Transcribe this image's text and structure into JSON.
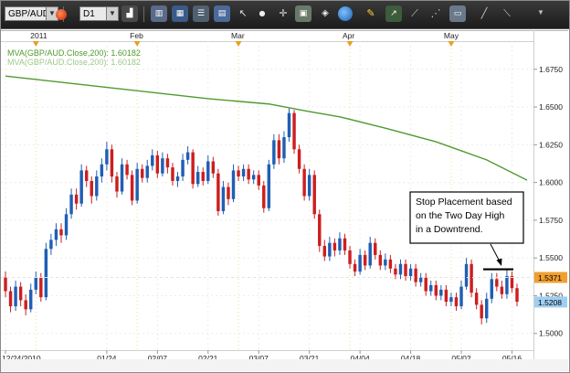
{
  "toolbar": {
    "symbol": "GBP/AUD",
    "timeframe": "D1",
    "icons": [
      "record-icon",
      "bar-chart-icon",
      "candle-icon",
      "line-chart-icon",
      "cursor-icon",
      "dot-icon",
      "crosshair-icon",
      "zoom-in-icon",
      "zoom-out-icon",
      "globe-icon",
      "pencil-icon",
      "trendline-icon",
      "channel-icon",
      "fibonacci-icon",
      "text-icon",
      "shapes-icon",
      "arrow-icon"
    ]
  },
  "colors": {
    "up": "#1f5fb4",
    "down": "#cc1f1f",
    "ma": "#4f9a2f",
    "ma_faint": "#9cc98a",
    "month_marker": "#e8a020",
    "price_box_orange": "#f0a030",
    "price_box_blue": "#9fcff0"
  },
  "chart_data": {
    "type": "candlestick",
    "symbol": "GBP/AUD",
    "ylim": [
      1.495,
      1.69
    ],
    "y_ticks": [
      "1.6750",
      "1.6500",
      "1.6250",
      "1.6000",
      "1.5750",
      "1.5500",
      "1.5250",
      "1.5000"
    ],
    "y_tick_values": [
      1.675,
      1.65,
      1.625,
      1.6,
      1.575,
      1.55,
      1.525,
      1.5
    ],
    "x_tick_labels": [
      "12/24/2010",
      "01/24",
      "02/07",
      "02/21",
      "03/07",
      "03/21",
      "04/04",
      "04/18",
      "05/02",
      "05/16"
    ],
    "x_tick_index": [
      0,
      20,
      30,
      40,
      50,
      60,
      70,
      80,
      90,
      100
    ],
    "month_labels": [
      "2011",
      "Feb",
      "Mar",
      "Apr",
      "May"
    ],
    "month_index": [
      6,
      26,
      46,
      68,
      88
    ],
    "legend": [
      "MVA(GBP/AUD.Close,200): 1.60182",
      "MVA(GBP/AUD.Close,200): 1.60182"
    ],
    "price_labels": {
      "current": "1.5371",
      "bid": "1.5208"
    },
    "price_values": {
      "current": 1.5371,
      "bid": 1.5208
    },
    "annotation": [
      "Stop Placement based",
      "on the Two Day High",
      "in a Downtrend."
    ],
    "stop_level": 1.5425,
    "ma": {
      "from_index": 0,
      "to_index": 103,
      "from_value": 1.6705,
      "to_value": 1.6015,
      "points": [
        [
          0,
          1.6705
        ],
        [
          20,
          1.663
        ],
        [
          40,
          1.6555
        ],
        [
          52,
          1.652
        ],
        [
          60,
          1.647
        ],
        [
          66,
          1.6435
        ],
        [
          75,
          1.636
        ],
        [
          85,
          1.627
        ],
        [
          95,
          1.615
        ],
        [
          103,
          1.6015
        ]
      ]
    },
    "candles": [
      [
        1.537,
        1.528,
        1.541,
        1.524
      ],
      [
        1.528,
        1.518,
        1.531,
        1.514
      ],
      [
        1.518,
        1.531,
        1.535,
        1.515
      ],
      [
        1.531,
        1.522,
        1.534,
        1.518
      ],
      [
        1.522,
        1.516,
        1.526,
        1.512
      ],
      [
        1.516,
        1.529,
        1.533,
        1.514
      ],
      [
        1.529,
        1.537,
        1.541,
        1.526
      ],
      [
        1.537,
        1.524,
        1.54,
        1.521
      ],
      [
        1.524,
        1.556,
        1.56,
        1.522
      ],
      [
        1.556,
        1.562,
        1.566,
        1.552
      ],
      [
        1.562,
        1.569,
        1.573,
        1.558
      ],
      [
        1.569,
        1.565,
        1.573,
        1.56
      ],
      [
        1.565,
        1.579,
        1.583,
        1.562
      ],
      [
        1.579,
        1.592,
        1.596,
        1.576
      ],
      [
        1.592,
        1.586,
        1.596,
        1.582
      ],
      [
        1.586,
        1.608,
        1.612,
        1.584
      ],
      [
        1.608,
        1.601,
        1.611,
        1.597
      ],
      [
        1.601,
        1.591,
        1.604,
        1.586
      ],
      [
        1.591,
        1.604,
        1.608,
        1.588
      ],
      [
        1.604,
        1.612,
        1.616,
        1.6
      ],
      [
        1.612,
        1.622,
        1.627,
        1.608
      ],
      [
        1.622,
        1.604,
        1.625,
        1.6
      ],
      [
        1.604,
        1.594,
        1.607,
        1.59
      ],
      [
        1.594,
        1.612,
        1.616,
        1.592
      ],
      [
        1.612,
        1.605,
        1.615,
        1.602
      ],
      [
        1.605,
        1.588,
        1.608,
        1.585
      ],
      [
        1.588,
        1.609,
        1.613,
        1.586
      ],
      [
        1.609,
        1.603,
        1.612,
        1.6
      ],
      [
        1.603,
        1.611,
        1.615,
        1.6
      ],
      [
        1.611,
        1.618,
        1.622,
        1.608
      ],
      [
        1.618,
        1.606,
        1.621,
        1.603
      ],
      [
        1.606,
        1.616,
        1.62,
        1.604
      ],
      [
        1.616,
        1.61,
        1.619,
        1.606
      ],
      [
        1.61,
        1.601,
        1.613,
        1.598
      ],
      [
        1.601,
        1.604,
        1.607,
        1.597
      ],
      [
        1.604,
        1.615,
        1.619,
        1.601
      ],
      [
        1.615,
        1.62,
        1.624,
        1.612
      ],
      [
        1.62,
        1.599,
        1.622,
        1.596
      ],
      [
        1.599,
        1.607,
        1.611,
        1.597
      ],
      [
        1.607,
        1.601,
        1.61,
        1.598
      ],
      [
        1.601,
        1.614,
        1.618,
        1.599
      ],
      [
        1.614,
        1.606,
        1.617,
        1.603
      ],
      [
        1.606,
        1.581,
        1.609,
        1.578
      ],
      [
        1.581,
        1.597,
        1.601,
        1.579
      ],
      [
        1.597,
        1.589,
        1.6,
        1.585
      ],
      [
        1.589,
        1.608,
        1.612,
        1.587
      ],
      [
        1.608,
        1.604,
        1.611,
        1.601
      ],
      [
        1.604,
        1.609,
        1.612,
        1.601
      ],
      [
        1.609,
        1.602,
        1.612,
        1.599
      ],
      [
        1.602,
        1.605,
        1.608,
        1.599
      ],
      [
        1.605,
        1.598,
        1.608,
        1.595
      ],
      [
        1.598,
        1.583,
        1.601,
        1.58
      ],
      [
        1.583,
        1.612,
        1.615,
        1.581
      ],
      [
        1.612,
        1.628,
        1.632,
        1.609
      ],
      [
        1.628,
        1.616,
        1.632,
        1.612
      ],
      [
        1.616,
        1.63,
        1.634,
        1.613
      ],
      [
        1.63,
        1.646,
        1.649,
        1.627
      ],
      [
        1.646,
        1.622,
        1.648,
        1.619
      ],
      [
        1.622,
        1.609,
        1.625,
        1.606
      ],
      [
        1.609,
        1.591,
        1.612,
        1.588
      ],
      [
        1.591,
        1.605,
        1.609,
        1.588
      ],
      [
        1.605,
        1.579,
        1.608,
        1.576
      ],
      [
        1.579,
        1.558,
        1.582,
        1.554
      ],
      [
        1.558,
        1.551,
        1.562,
        1.548
      ],
      [
        1.551,
        1.56,
        1.564,
        1.548
      ],
      [
        1.56,
        1.555,
        1.563,
        1.551
      ],
      [
        1.555,
        1.563,
        1.567,
        1.552
      ],
      [
        1.563,
        1.555,
        1.566,
        1.552
      ],
      [
        1.555,
        1.546,
        1.558,
        1.543
      ],
      [
        1.546,
        1.541,
        1.549,
        1.538
      ],
      [
        1.541,
        1.552,
        1.556,
        1.539
      ],
      [
        1.552,
        1.545,
        1.555,
        1.542
      ],
      [
        1.545,
        1.56,
        1.564,
        1.543
      ],
      [
        1.56,
        1.552,
        1.563,
        1.549
      ],
      [
        1.552,
        1.545,
        1.555,
        1.542
      ],
      [
        1.545,
        1.549,
        1.553,
        1.542
      ],
      [
        1.549,
        1.543,
        1.552,
        1.54
      ],
      [
        1.543,
        1.539,
        1.546,
        1.536
      ],
      [
        1.539,
        1.546,
        1.549,
        1.536
      ],
      [
        1.546,
        1.538,
        1.549,
        1.535
      ],
      [
        1.538,
        1.543,
        1.546,
        1.535
      ],
      [
        1.543,
        1.534,
        1.546,
        1.531
      ],
      [
        1.534,
        1.537,
        1.54,
        1.531
      ],
      [
        1.537,
        1.528,
        1.54,
        1.525
      ],
      [
        1.528,
        1.532,
        1.535,
        1.525
      ],
      [
        1.532,
        1.525,
        1.535,
        1.522
      ],
      [
        1.525,
        1.529,
        1.532,
        1.522
      ],
      [
        1.529,
        1.521,
        1.532,
        1.518
      ],
      [
        1.521,
        1.524,
        1.527,
        1.518
      ],
      [
        1.524,
        1.518,
        1.527,
        1.515
      ],
      [
        1.518,
        1.531,
        1.535,
        1.516
      ],
      [
        1.531,
        1.546,
        1.55,
        1.529
      ],
      [
        1.546,
        1.527,
        1.549,
        1.524
      ],
      [
        1.527,
        1.519,
        1.53,
        1.516
      ],
      [
        1.519,
        1.51,
        1.522,
        1.506
      ],
      [
        1.51,
        1.523,
        1.527,
        1.507
      ],
      [
        1.523,
        1.536,
        1.54,
        1.52
      ],
      [
        1.536,
        1.531,
        1.54,
        1.528
      ],
      [
        1.531,
        1.526,
        1.535,
        1.523
      ],
      [
        1.526,
        1.538,
        1.542,
        1.523
      ],
      [
        1.538,
        1.53,
        1.541,
        1.527
      ],
      [
        1.53,
        1.521,
        1.533,
        1.518
      ]
    ]
  }
}
